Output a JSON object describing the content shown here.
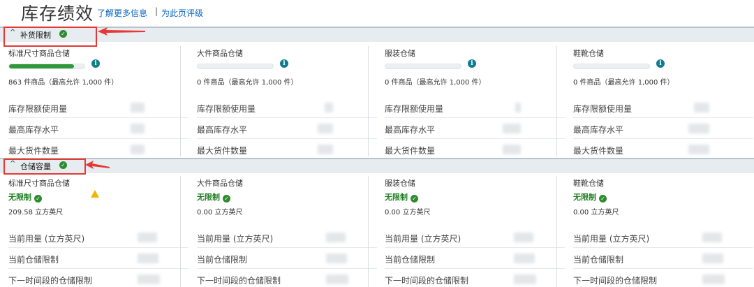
{
  "header": {
    "title": "库存绩效",
    "learn_more": "了解更多信息",
    "separator": "|",
    "rate_page": "为此页评级"
  },
  "restock": {
    "chevron": "^",
    "title": "补货限制",
    "warehouses": [
      {
        "name": "标准尺寸商品仓储",
        "count_text": "863 件商品（最高允许 1,000 件）",
        "utilization": 0.863
      },
      {
        "name": "大件商品仓储",
        "count_text": "0 件商品（最高允许 1,000 件）",
        "utilization": 0
      },
      {
        "name": "服装仓储",
        "count_text": "0 件商品（最高允许 1,000 件）",
        "utilization": 0
      },
      {
        "name": "鞋靴仓储",
        "count_text": "0 件商品（最高允许 1,000 件）",
        "utilization": 0
      }
    ],
    "metrics": [
      "库存限额使用量",
      "最高库存水平",
      "最大货件数量"
    ]
  },
  "storage": {
    "chevron": "^",
    "title": "仓储容量",
    "warehouses": [
      {
        "name": "标准尺寸商品仓储",
        "status": "无限制",
        "volume": "209.58 立方英尺",
        "warning": true
      },
      {
        "name": "大件商品仓储",
        "status": "无限制",
        "volume": "0.00 立方英尺",
        "warning": false
      },
      {
        "name": "服装仓储",
        "status": "无限制",
        "volume": "0.00 立方英尺",
        "warning": false
      },
      {
        "name": "鞋靴仓储",
        "status": "无限制",
        "volume": "0.00 立方英尺",
        "warning": false
      }
    ],
    "metrics": [
      "当前用量 (立方英尺)",
      "当前仓储限制",
      "下一时间段的仓储限制"
    ]
  },
  "colors": {
    "accent_green": "#2e9a3a",
    "link_blue": "#0a66c2",
    "annotation_red": "#e53935"
  },
  "icons": {
    "check": "✓",
    "info": "i"
  }
}
